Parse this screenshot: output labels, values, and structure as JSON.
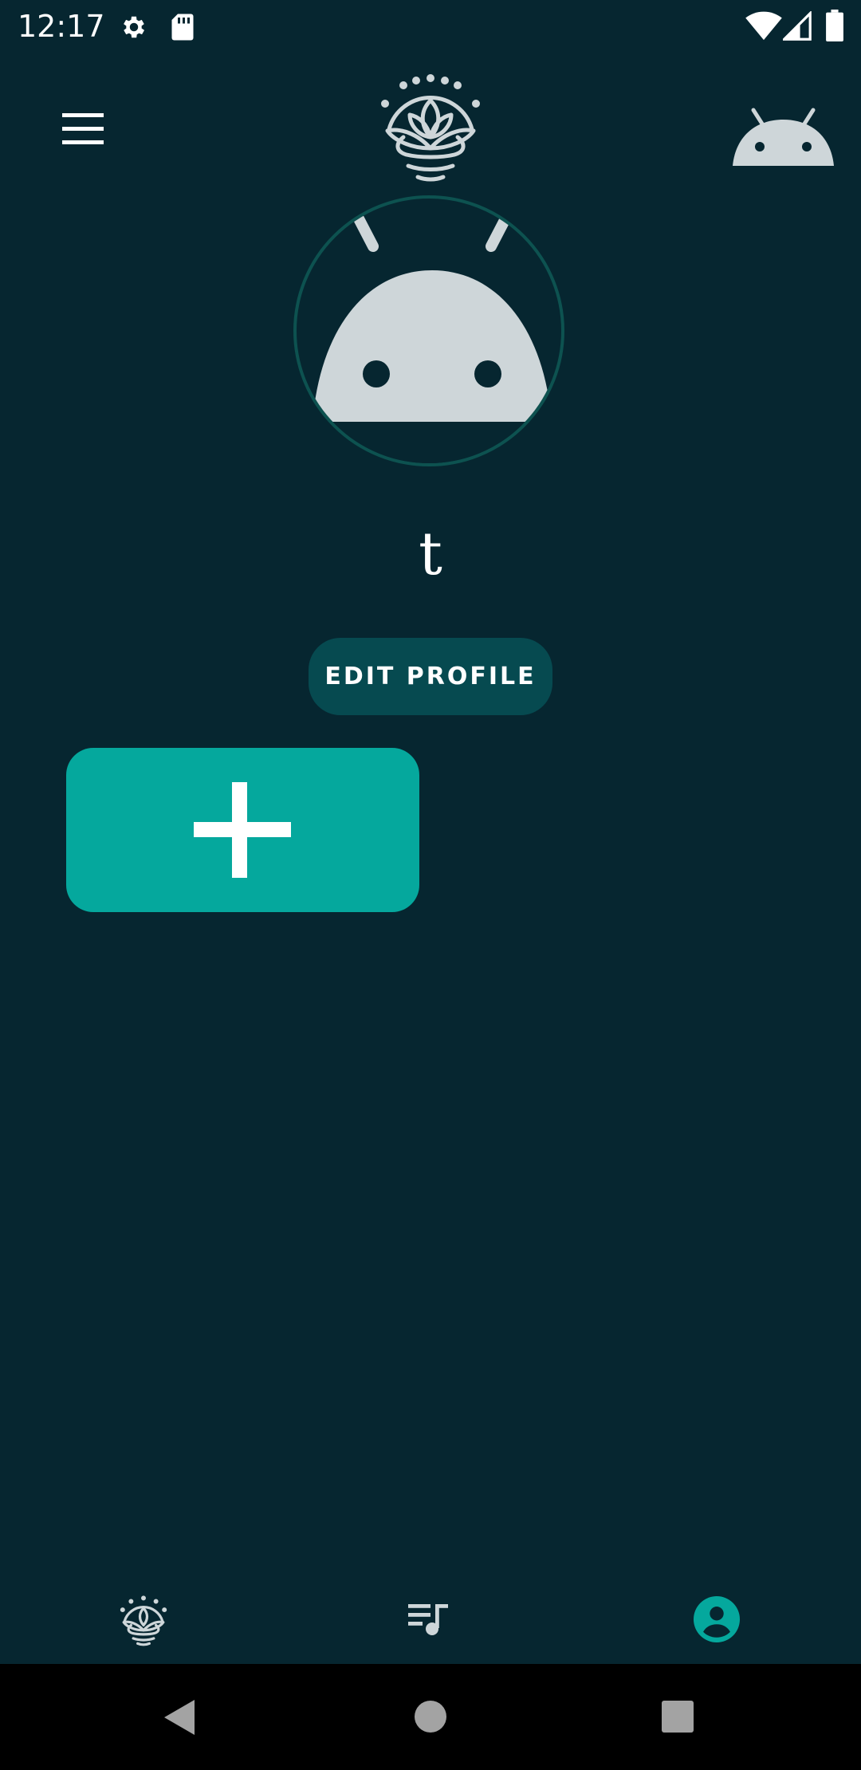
{
  "status_bar": {
    "time": "12:17",
    "icons": [
      "gear-icon",
      "sd-card-icon",
      "wifi-icon",
      "signal-icon",
      "battery-icon"
    ]
  },
  "toolbar": {
    "menu_icon": "hamburger-menu-icon",
    "logo_icon": "lotus-logo-icon",
    "avatar_icon": "android-avatar-icon"
  },
  "profile": {
    "name": "t",
    "edit_button_label": "EDIT PROFILE",
    "add_icon": "plus-icon"
  },
  "bottom_nav": {
    "items": [
      {
        "icon": "lotus-meditate-icon",
        "active": false
      },
      {
        "icon": "playlist-music-icon",
        "active": false
      },
      {
        "icon": "account-circle-icon",
        "active": true
      }
    ]
  },
  "system_nav": {
    "items": [
      "back-icon",
      "home-icon",
      "recents-icon"
    ]
  },
  "colors": {
    "background": "#062630",
    "accent": "#05a89d",
    "edit_button_bg": "#064a50",
    "avatar_ring": "#0d5250",
    "icon_light": "#ced6d9",
    "system_nav_bg": "#000000"
  }
}
